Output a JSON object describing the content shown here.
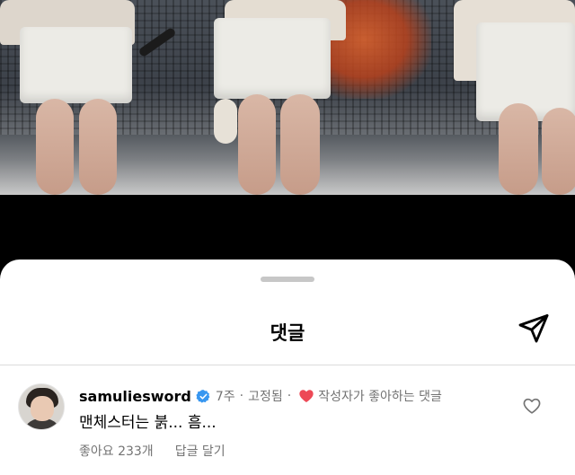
{
  "sheet": {
    "title": "댓글"
  },
  "icons": {
    "share": "paper-plane-icon",
    "verified": "verified-badge-icon",
    "creator_heart": "heart-filled-icon",
    "like": "heart-outline-icon"
  },
  "colors": {
    "verified_blue": "#3897f0",
    "heart_red": "#ed4956",
    "secondary_text": "#737373"
  },
  "comment": {
    "username": "samuliesword",
    "age": "7주",
    "separator": "·",
    "pinned": "고정됨",
    "liked_by_creator": "작성자가 좋아하는 댓글",
    "text": "맨체스터는 붉... 흠...",
    "likes": "좋아요 233개",
    "reply": "답글 달기"
  }
}
